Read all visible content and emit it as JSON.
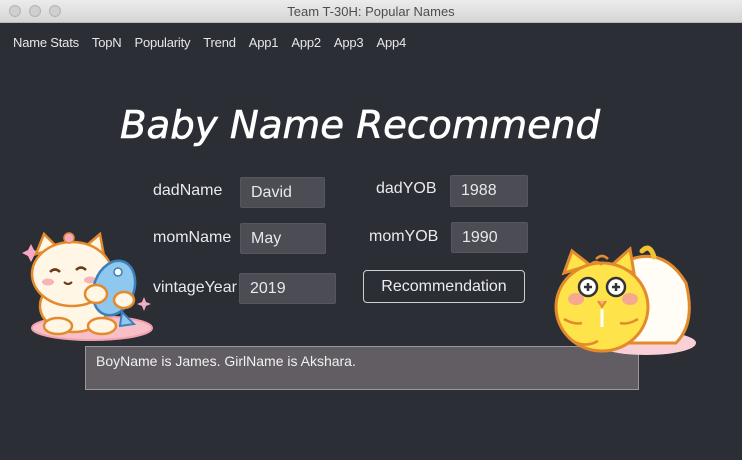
{
  "window": {
    "title": "Team T-30H: Popular Names"
  },
  "menu": {
    "items": [
      "Name Stats",
      "TopN",
      "Popularity",
      "Trend",
      "App1",
      "App2",
      "App3",
      "App4"
    ]
  },
  "heading": "Baby Name Recommend",
  "form": {
    "dad_name": {
      "label": "dadName",
      "value": "David"
    },
    "dad_yob": {
      "label": "dadYOB",
      "value": "1988"
    },
    "mom_name": {
      "label": "momName",
      "value": "May"
    },
    "mom_yob": {
      "label": "momYOB",
      "value": "1990"
    },
    "vintage_year": {
      "label": "vintageYear",
      "value": "2019"
    },
    "button_label": "Recommendation"
  },
  "result": "BoyName is James. GirlName is Akshara.",
  "colors": {
    "background": "#2c2e36",
    "field": "#4b4c54",
    "result_box": "#625d62",
    "text": "#e9e9ee"
  },
  "icons": {
    "left_sticker": "cat-with-fish-icon",
    "right_sticker": "yellow-cat-in-bowl-icon"
  }
}
